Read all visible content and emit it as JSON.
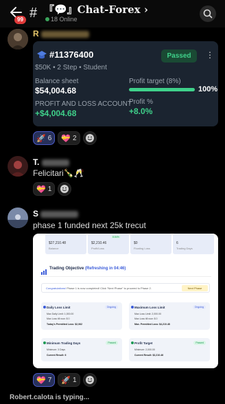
{
  "header": {
    "badge": "99",
    "hash": "#",
    "title": "『💬』Chat-Forex ›",
    "online": "18 Online"
  },
  "msg1": {
    "name_initial": "R",
    "card": {
      "account": "#11376400",
      "status": "Passed",
      "subtitle": "$50K  •  2 Step  •  Student",
      "balance_label": "Balance sheet",
      "balance_value": "$54,004.68",
      "pnl_label": "PROFIT AND LOSS ACCOUNT",
      "pnl_value": "+$4,004.68",
      "target_label": "Profit target (8%)",
      "target_pct": "100%",
      "target_progress": 1.0,
      "profit_pct_label": "Profit %",
      "profit_pct_value": "+8.0%",
      "accent": "#3fd18a"
    },
    "reactions": [
      {
        "emoji": "🚀",
        "count": "6",
        "active": true
      },
      {
        "emoji": "💝",
        "count": "2",
        "active": false
      }
    ]
  },
  "msg2": {
    "name_initial": "T.",
    "text": "Felicitari🍾🥂",
    "reactions": [
      {
        "emoji": "💝",
        "count": "1",
        "active": false
      }
    ]
  },
  "msg3": {
    "name_initial": "S",
    "text": "phase 1 funded next 25k trecut",
    "shot": {
      "stats": [
        {
          "value": "$27,210.48",
          "label": "Balance"
        },
        {
          "value": "$2,210.46",
          "label": "Profit/Loss",
          "badge": "8.84%"
        },
        {
          "value": "$0",
          "label": "Floating Loss"
        },
        {
          "value": "6",
          "label": "Trading Days"
        }
      ],
      "objective_title": "Trading Objective",
      "refresh": "(Refreshing in 04:46)",
      "congrats_bold": "Congratulations!",
      "congrats_text": " Phase 1 is now completed! Click \"Next Phase\" to proceed to Phase 2.",
      "next_phase": "Next Phase",
      "boxes": [
        {
          "title": "Daily Loss Limit",
          "status": "Ongoing",
          "lines": [
            "Max Daily Limit: 1,000.00",
            "Max Loss till now: $ 0",
            "Today's Permitted Loss: $2,062"
          ]
        },
        {
          "title": "Maximum Loss Limit",
          "status": "Ongoing",
          "lines": [
            "Max Loss Limit: 2,000.00",
            "Max Loss till now: $ 0",
            "Max. Permitted Loss: $4,210.48"
          ]
        },
        {
          "title": "Minimum Trading Days",
          "status": "Passed",
          "lines": [
            "Minimum: 3 Days",
            "Current Result: 6"
          ]
        },
        {
          "title": "Profit Target",
          "status": "Passed",
          "lines": [
            "Minimum: 2,000.00",
            "Current Result: $2,210.46"
          ]
        }
      ]
    },
    "reactions": [
      {
        "emoji": "💝",
        "count": "7",
        "active": true
      },
      {
        "emoji": "🚀",
        "count": "1",
        "active": false
      }
    ]
  },
  "typing": "Robert.calota is typing..."
}
